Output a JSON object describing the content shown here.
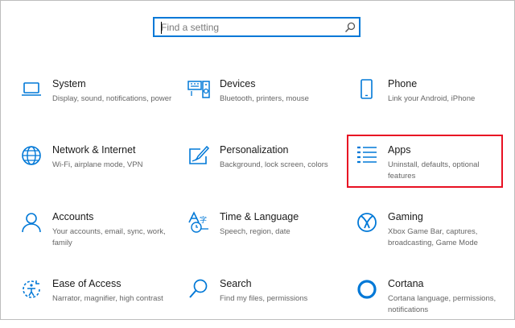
{
  "search": {
    "placeholder": "Find a setting",
    "icon": "search-icon"
  },
  "accent_color": "#0078d7",
  "highlight_color": "#e81123",
  "tiles": [
    {
      "title": "System",
      "desc": "Display, sound, notifications, power",
      "icon": "laptop-icon"
    },
    {
      "title": "Devices",
      "desc": "Bluetooth, printers, mouse",
      "icon": "keyboard-speaker-icon"
    },
    {
      "title": "Phone",
      "desc": "Link your Android, iPhone",
      "icon": "phone-icon"
    },
    {
      "title": "Network & Internet",
      "desc": "Wi-Fi, airplane mode, VPN",
      "icon": "globe-icon"
    },
    {
      "title": "Personalization",
      "desc": "Background, lock screen, colors",
      "icon": "paint-brush-icon"
    },
    {
      "title": "Apps",
      "desc": "Uninstall, defaults, optional features",
      "icon": "apps-list-icon",
      "highlighted": true
    },
    {
      "title": "Accounts",
      "desc": "Your accounts, email, sync, work, family",
      "icon": "person-icon"
    },
    {
      "title": "Time & Language",
      "desc": "Speech, region, date",
      "icon": "time-language-icon"
    },
    {
      "title": "Gaming",
      "desc": "Xbox Game Bar, captures, broadcasting, Game Mode",
      "icon": "xbox-icon"
    },
    {
      "title": "Ease of Access",
      "desc": "Narrator, magnifier, high contrast",
      "icon": "ease-of-access-icon"
    },
    {
      "title": "Search",
      "desc": "Find my files, permissions",
      "icon": "magnifier-icon"
    },
    {
      "title": "Cortana",
      "desc": "Cortana language, permissions, notifications",
      "icon": "cortana-icon"
    }
  ]
}
